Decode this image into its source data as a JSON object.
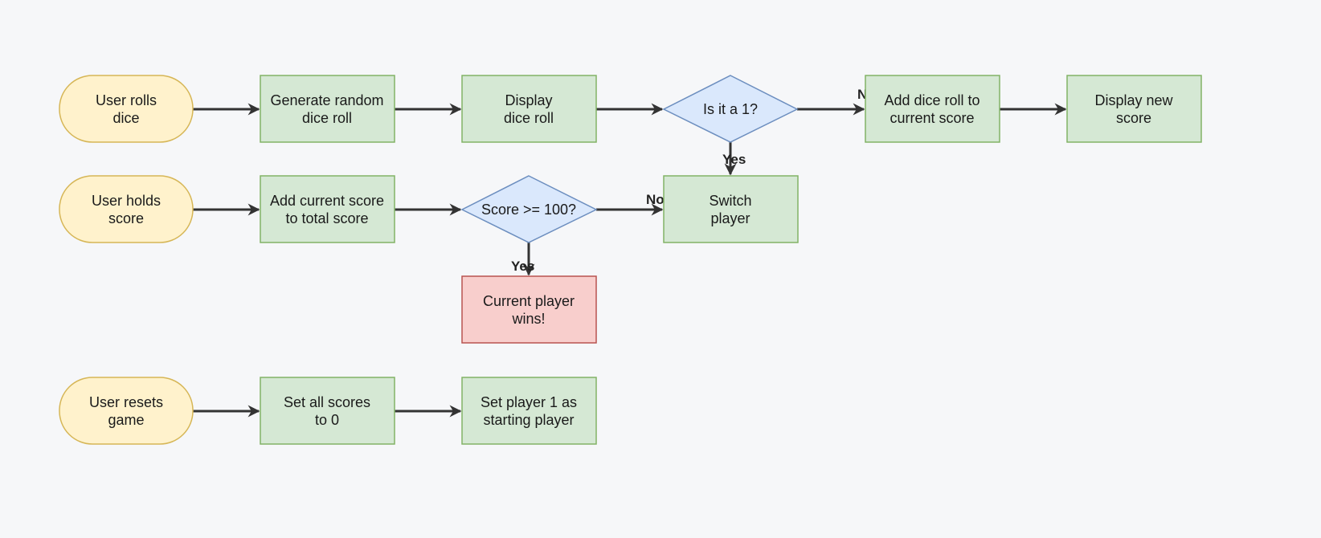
{
  "colors": {
    "background": "#f6f7f9",
    "terminal_fill": "#fff2cc",
    "terminal_stroke": "#d6b656",
    "process_fill": "#d5e8d4",
    "process_stroke": "#82b366",
    "decision_fill": "#dae8fc",
    "decision_stroke": "#6c8ebf",
    "end_fill": "#f8cecc",
    "end_stroke": "#b85450",
    "edge": "#333333"
  },
  "nodes": {
    "rolls": {
      "lines": [
        "User rolls",
        "dice"
      ]
    },
    "generate": {
      "lines": [
        "Generate random",
        "dice roll"
      ]
    },
    "display_roll": {
      "lines": [
        "Display",
        "dice roll"
      ]
    },
    "is_one": {
      "lines": [
        "Is it a 1?"
      ]
    },
    "add_roll": {
      "lines": [
        "Add dice roll to",
        "current score"
      ]
    },
    "display_score": {
      "lines": [
        "Display new",
        "score"
      ]
    },
    "holds": {
      "lines": [
        "User holds",
        "score"
      ]
    },
    "add_total": {
      "lines": [
        "Add current score",
        "to total score"
      ]
    },
    "score_check": {
      "lines": [
        "Score >= 100?"
      ]
    },
    "switch": {
      "lines": [
        "Switch",
        "player"
      ]
    },
    "wins": {
      "lines": [
        "Current player",
        "wins!"
      ]
    },
    "resets": {
      "lines": [
        "User resets",
        "game"
      ]
    },
    "set_zero": {
      "lines": [
        "Set all scores",
        "to 0"
      ]
    },
    "set_p1": {
      "lines": [
        "Set player 1 as",
        "starting player"
      ]
    }
  },
  "edge_labels": {
    "is_one_no": "No",
    "is_one_yes": "Yes",
    "score_no": "No",
    "score_yes": "Yes"
  }
}
